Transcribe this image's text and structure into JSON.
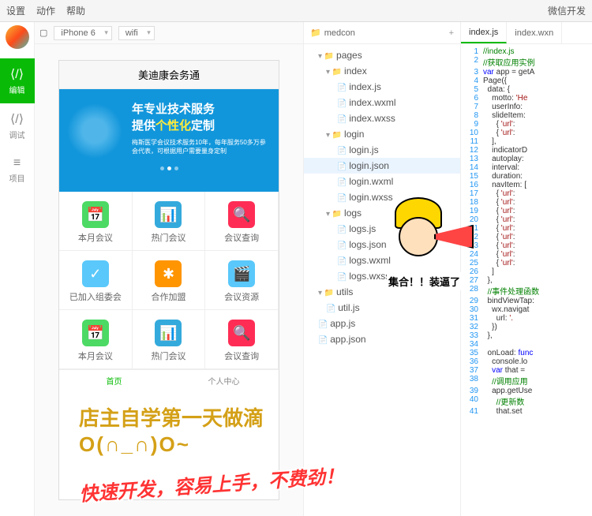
{
  "topmenu": {
    "settings": "设置",
    "actions": "动作",
    "help": "帮助",
    "right": "微信开发"
  },
  "leftbar": {
    "edit": "编辑",
    "debug": "调试",
    "project": "项目"
  },
  "device": {
    "model": "iPhone 6",
    "network": "wifi"
  },
  "phone": {
    "title": "美迪康会务通",
    "banner_l1": "年专业技术服务",
    "banner_l2a": "提供",
    "banner_l2b": "个性化",
    "banner_l2c": "定制",
    "banner_desc": "梅斯医学会议技术服务10年，每年服务50多万参会代表，可根据用户需要量身定制",
    "grid": [
      {
        "label": "本月会议",
        "color": "c-green",
        "icon": "📅"
      },
      {
        "label": "热门会议",
        "color": "c-blue",
        "icon": "📊"
      },
      {
        "label": "会议查询",
        "color": "c-pink",
        "icon": "🔍"
      },
      {
        "label": "已加入组委会",
        "color": "c-teal",
        "icon": "✓"
      },
      {
        "label": "合作加盟",
        "color": "c-orange",
        "icon": "✱"
      },
      {
        "label": "会议资源",
        "color": "c-teal",
        "icon": "🎬"
      },
      {
        "label": "本月会议",
        "color": "c-green",
        "icon": "📅"
      },
      {
        "label": "热门会议",
        "color": "c-blue",
        "icon": "📊"
      },
      {
        "label": "会议查询",
        "color": "c-pink",
        "icon": "🔍"
      }
    ],
    "tab_home": "首页",
    "tab_me": "个人中心"
  },
  "files": {
    "project": "medcon",
    "tree": [
      {
        "name": "pages",
        "type": "fold",
        "open": true,
        "lv": 0
      },
      {
        "name": "index",
        "type": "fold",
        "open": true,
        "lv": 1
      },
      {
        "name": "index.js",
        "type": "file",
        "lv": 2
      },
      {
        "name": "index.wxml",
        "type": "file",
        "lv": 2
      },
      {
        "name": "index.wxss",
        "type": "file",
        "lv": 2
      },
      {
        "name": "login",
        "type": "fold",
        "open": true,
        "lv": 1
      },
      {
        "name": "login.js",
        "type": "file",
        "lv": 2
      },
      {
        "name": "login.json",
        "type": "file",
        "lv": 2,
        "sel": true
      },
      {
        "name": "login.wxml",
        "type": "file",
        "lv": 2
      },
      {
        "name": "login.wxss",
        "type": "file",
        "lv": 2
      },
      {
        "name": "logs",
        "type": "fold",
        "open": true,
        "lv": 1
      },
      {
        "name": "logs.js",
        "type": "file",
        "lv": 2
      },
      {
        "name": "logs.json",
        "type": "file",
        "lv": 2
      },
      {
        "name": "logs.wxml",
        "type": "file",
        "lv": 2
      },
      {
        "name": "logs.wxss",
        "type": "file",
        "lv": 2
      },
      {
        "name": "utils",
        "type": "fold",
        "open": true,
        "lv": 0
      },
      {
        "name": "util.js",
        "type": "file",
        "lv": 1
      },
      {
        "name": "app.js",
        "type": "file",
        "lv": 0
      },
      {
        "name": "app.json",
        "type": "file",
        "lv": 0
      }
    ]
  },
  "editor": {
    "tab_active": "index.js",
    "tab_other": "index.wxn",
    "lines": [
      {
        "n": 1,
        "html": "<span class='cm'>//index.js</span>"
      },
      {
        "n": 2,
        "html": "<span class='cm'>//获取应用实例</span>"
      },
      {
        "n": 3,
        "html": "<span class='kw'>var</span> app = getA"
      },
      {
        "n": 4,
        "html": "Page({"
      },
      {
        "n": 5,
        "html": "  data: {"
      },
      {
        "n": 6,
        "html": "    motto: <span class='str'>'He</span>"
      },
      {
        "n": 7,
        "html": "    userInfo:"
      },
      {
        "n": 8,
        "html": "    slideItem:"
      },
      {
        "n": 9,
        "html": "      { <span class='str'>'url'</span>:"
      },
      {
        "n": 10,
        "html": "      { <span class='str'>'url'</span>:"
      },
      {
        "n": 11,
        "html": "    ],"
      },
      {
        "n": 12,
        "html": "    indicatorD"
      },
      {
        "n": 13,
        "html": "    autoplay:"
      },
      {
        "n": 14,
        "html": "    interval:"
      },
      {
        "n": 15,
        "html": "    duration:"
      },
      {
        "n": 16,
        "html": "    navItem: ["
      },
      {
        "n": 17,
        "html": "      { <span class='str'>'url'</span>:"
      },
      {
        "n": 18,
        "html": "      { <span class='str'>'url'</span>:"
      },
      {
        "n": 19,
        "html": "      { <span class='str'>'url'</span>:"
      },
      {
        "n": 20,
        "html": "      { <span class='str'>'url'</span>:"
      },
      {
        "n": 21,
        "html": "      { <span class='str'>'url'</span>:"
      },
      {
        "n": 22,
        "html": "      { <span class='str'>'url'</span>:"
      },
      {
        "n": 23,
        "html": "      { <span class='str'>'url'</span>:"
      },
      {
        "n": 24,
        "html": "      { <span class='str'>'url'</span>:"
      },
      {
        "n": 25,
        "html": "      { <span class='str'>'url'</span>:"
      },
      {
        "n": 26,
        "html": "    ]"
      },
      {
        "n": 27,
        "html": "  },"
      },
      {
        "n": 28,
        "html": "  <span class='cm'>//事件处理函数</span>"
      },
      {
        "n": 29,
        "html": "  bindViewTap:"
      },
      {
        "n": 30,
        "html": "    wx.navigat"
      },
      {
        "n": 31,
        "html": "      url: <span class='str'>'.</span>"
      },
      {
        "n": 32,
        "html": "    })"
      },
      {
        "n": 33,
        "html": "  },"
      },
      {
        "n": 34,
        "html": ""
      },
      {
        "n": 35,
        "html": "  onLoad: <span class='kw'>func</span>"
      },
      {
        "n": 36,
        "html": "    console.lo"
      },
      {
        "n": 37,
        "html": "    <span class='kw'>var</span> that ="
      },
      {
        "n": 38,
        "html": "    <span class='cm'>//调用应用</span>"
      },
      {
        "n": 39,
        "html": "    app.getUse"
      },
      {
        "n": 40,
        "html": "      <span class='cm'>//更新数</span>"
      },
      {
        "n": 41,
        "html": "      that.set"
      }
    ]
  },
  "overlay": {
    "line1": "店主自学第一天做滴",
    "line2": "O(∩_∩)O~",
    "line3": "快速开发，容易上手，不费劲！",
    "sticker_caption": "集合！！装逼了"
  }
}
